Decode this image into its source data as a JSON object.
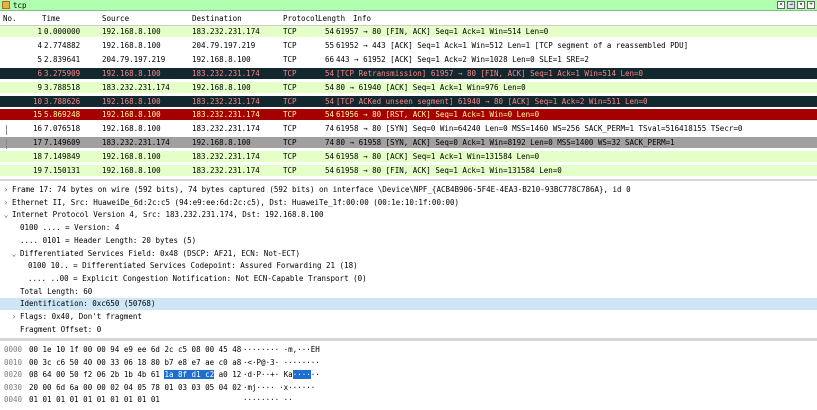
{
  "filter": {
    "text": "tcp",
    "clear_icon": "x-icon",
    "apply_icon": "arrow-right-icon",
    "dropdown_icon": "chevron-down-icon",
    "add_icon": "plus-icon"
  },
  "columns": {
    "no": "No.",
    "time": "Time",
    "source": "Source",
    "destination": "Destination",
    "protocol": "Protocol",
    "length": "Length",
    "info": "Info"
  },
  "colors": {
    "green": "#e4ffc7",
    "dark": "#12272e",
    "dark_text": "#f78787",
    "red": "#a40000",
    "red_text": "#fffc9c",
    "gray": "#a0a0a0"
  },
  "packets": [
    {
      "no": "1",
      "time": "0.000000",
      "src": "192.168.8.100",
      "dst": "183.232.231.174",
      "proto": "TCP",
      "len": "54",
      "info": "61957 → 80 [FIN, ACK] Seq=1 Ack=1 Win=514 Len=0",
      "style": "green"
    },
    {
      "no": "4",
      "time": "2.774882",
      "src": "192.168.8.100",
      "dst": "204.79.197.219",
      "proto": "TCP",
      "len": "55",
      "info": "61952 → 443 [ACK] Seq=1 Ack=1 Win=512 Len=1 [TCP segment of a reassembled PDU]",
      "style": "white"
    },
    {
      "no": "5",
      "time": "2.839641",
      "src": "204.79.197.219",
      "dst": "192.168.8.100",
      "proto": "TCP",
      "len": "66",
      "info": "443 → 61952 [ACK] Seq=1 Ack=2 Win=1028 Len=0 SLE=1 SRE=2",
      "style": "white"
    },
    {
      "no": "6",
      "time": "3.275909",
      "src": "192.168.8.100",
      "dst": "183.232.231.174",
      "proto": "TCP",
      "len": "54",
      "info": "[TCP Retransmission] 61957 → 80 [FIN, ACK] Seq=1 Ack=1 Win=514 Len=0",
      "style": "dark"
    },
    {
      "no": "9",
      "time": "3.788518",
      "src": "183.232.231.174",
      "dst": "192.168.8.100",
      "proto": "TCP",
      "len": "54",
      "info": "80 → 61940 [ACK] Seq=1 Ack=1 Win=976 Len=0",
      "style": "green"
    },
    {
      "no": "10",
      "time": "3.788626",
      "src": "192.168.8.100",
      "dst": "183.232.231.174",
      "proto": "TCP",
      "len": "54",
      "info": "[TCP ACKed unseen segment] 61940 → 80 [ACK] Seq=1 Ack=2 Win=511 Len=0",
      "style": "dark"
    },
    {
      "no": "15",
      "time": "5.869248",
      "src": "192.168.8.100",
      "dst": "183.232.231.174",
      "proto": "TCP",
      "len": "54",
      "info": "61956 → 80 [RST, ACK] Seq=1 Ack=1 Win=0 Len=0",
      "style": "red"
    },
    {
      "no": "16",
      "time": "7.076518",
      "src": "192.168.8.100",
      "dst": "183.232.231.174",
      "proto": "TCP",
      "len": "74",
      "info": "61958 → 80 [SYN] Seq=0 Win=64240 Len=0 MSS=1460 WS=256 SACK_PERM=1 TSval=516418155 TSecr=0",
      "style": "gray"
    },
    {
      "no": "17",
      "time": "7.149609",
      "src": "183.232.231.174",
      "dst": "192.168.8.100",
      "proto": "TCP",
      "len": "74",
      "info": "80 → 61958 [SYN, ACK] Seq=0 Ack=1 Win=8192 Len=0 MSS=1400 WS=32 SACK_PERM=1",
      "style": "selected"
    },
    {
      "no": "18",
      "time": "7.149849",
      "src": "192.168.8.100",
      "dst": "183.232.231.174",
      "proto": "TCP",
      "len": "54",
      "info": "61958 → 80 [ACK] Seq=1 Ack=1 Win=131584 Len=0",
      "style": "green"
    },
    {
      "no": "19",
      "time": "7.150131",
      "src": "192.168.8.100",
      "dst": "183.232.231.174",
      "proto": "TCP",
      "len": "54",
      "info": "61958 → 80 [FIN, ACK] Seq=1 Ack=1 Win=131584 Len=0",
      "style": "green"
    }
  ],
  "details": [
    {
      "arrow": "›",
      "text": "Frame 17: 74 bytes on wire (592 bits), 74 bytes captured (592 bits) on interface \\Device\\NPF_{ACB4B906-5F4E-4EA3-B210-93BC778C786A}, id 0",
      "indent": 0
    },
    {
      "arrow": "›",
      "text": "Ethernet II, Src: HuaweiDe_6d:2c:c5 (94:e9:ee:6d:2c:c5), Dst: HuaweiTe_1f:00:00 (00:1e:10:1f:00:00)",
      "indent": 0
    },
    {
      "arrow": "⌄",
      "text": "Internet Protocol Version 4, Src: 183.232.231.174, Dst: 192.168.8.100",
      "indent": 0
    },
    {
      "arrow": "",
      "text": "0100 .... = Version: 4",
      "indent": 1
    },
    {
      "arrow": "",
      "text": ".... 0101 = Header Length: 20 bytes (5)",
      "indent": 1
    },
    {
      "arrow": "⌄",
      "text": "Differentiated Services Field: 0x48 (DSCP: AF21, ECN: Not-ECT)",
      "indent": 1
    },
    {
      "arrow": "",
      "text": "0100 10.. = Differentiated Services Codepoint: Assured Forwarding 21 (18)",
      "indent": 2
    },
    {
      "arrow": "",
      "text": ".... ..00 = Explicit Congestion Notification: Not ECN-Capable Transport (0)",
      "indent": 2
    },
    {
      "arrow": "",
      "text": "Total Length: 60",
      "indent": 1
    },
    {
      "arrow": "",
      "text": "Identification: 0xc650 (50768)",
      "indent": 1,
      "selected": true
    },
    {
      "arrow": "›",
      "text": "Flags: 0x40, Don't fragment",
      "indent": 1
    },
    {
      "arrow": "",
      "text": "Fragment Offset: 0",
      "indent": 1
    }
  ],
  "hex": [
    {
      "off": "0000",
      "pre": "00 1e 10 1f 00 00 94 e9  ee 6d 2c c5 08 00 45 48",
      "hl": "",
      "post": "",
      "apre": "········ ·m,···EH",
      "ahl": "",
      "apost": ""
    },
    {
      "off": "0010",
      "pre": "00 3c c6 50 40 00 33 06  18 80 b7 e8 e7 ae c0 a8",
      "hl": "",
      "post": "",
      "apre": "·<·P@·3· ········",
      "ahl": "",
      "apost": ""
    },
    {
      "off": "0020",
      "pre": "08 64 00 50 f2 06 2b 1b  4b 61 ",
      "hl": "1a 8f d1 c2",
      "post": " a0 12",
      "apre": "·d·P··+· Ka",
      "ahl": "····",
      "apost": "··"
    },
    {
      "off": "0030",
      "pre": "20 00 6d 6a 00 00 02 04  05 78 01 03 03 05 04 02",
      "hl": "",
      "post": "",
      "apre": " ·mj···· ·x······",
      "ahl": "",
      "apost": ""
    },
    {
      "off": "0040",
      "pre": "01 01 01 01 01 01 01 01  01 01",
      "hl": "",
      "post": "",
      "apre": "········ ··",
      "ahl": "",
      "apost": ""
    }
  ]
}
